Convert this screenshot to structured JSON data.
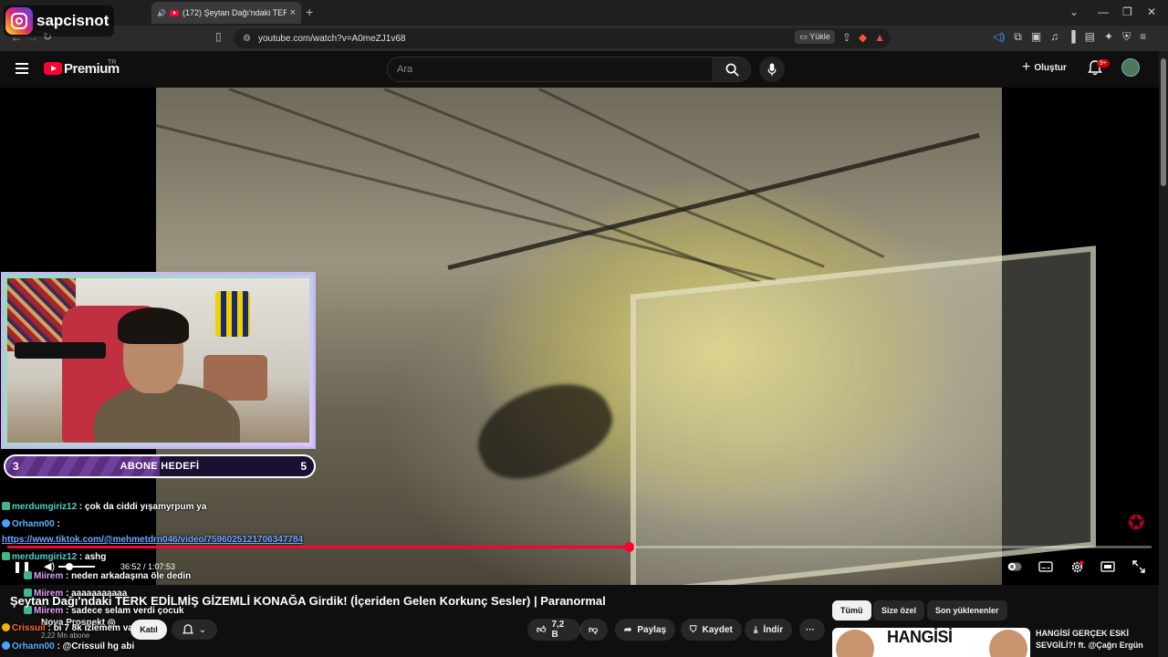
{
  "browser": {
    "tab_title": "(172) Şeytan Dağı'ndaki TERK",
    "tab_close": "×",
    "new_tab": "+",
    "url": "youtube.com/watch?v=A0meZJ1v68",
    "install_label": "Yükle"
  },
  "overlay": {
    "instagram_handle": "sapcisnot"
  },
  "yt_header": {
    "logo_text": "Premium",
    "region": "TR",
    "search_placeholder": "Ara",
    "create_label": "Oluştur",
    "notification_count": "9+"
  },
  "player": {
    "current_time": "36:52",
    "duration": "1:07:53",
    "time_display": "36:52 / 1:07:53",
    "progress_fraction": 0.543
  },
  "sub_goal": {
    "current": "3",
    "target": "5",
    "label": "ABONE HEDEFİ",
    "fraction": 0.5
  },
  "chat": [
    {
      "user": "merdumgiriz12",
      "sep": " : ",
      "text": "çok da ciddi yışamyrpum ya"
    },
    {
      "user": "Orhann00",
      "sep": " : ",
      "text": ""
    },
    {
      "user": "",
      "sep": "",
      "text": "https://www.tiktok.com/@mehmetdrn046/video/7596025121706347784"
    },
    {
      "user": "merdumgiriz12",
      "sep": " : ",
      "text": "ashg"
    },
    {
      "user": "Miirem",
      "sep": " : ",
      "text": "neden arkadaşına öle dedin"
    },
    {
      "user": "Miirem",
      "sep": " : ",
      "text": "aaaaaaaaaaa"
    },
    {
      "user": "Miirem",
      "sep": " : ",
      "text": "sadece selam verdi çocuk"
    },
    {
      "user": "Crissuil",
      "sep": " : ",
      "text": "bi 7 8k izlemem vardı"
    },
    {
      "user": "Orhann00",
      "sep": " : ",
      "text": "@Crissuil hg abi"
    }
  ],
  "video": {
    "title": "Şeytan Dağı'ndaki TERK EDİLMİŞ GİZEMLİ KONAĞA Girdik! (İçeriden Gelen Korkunç Sesler) | Paranormal",
    "channel": "Nova Prospekt",
    "channel_suffix": "◎",
    "subscribers": "2,22 Mn abone",
    "join_label": "Katıl",
    "likes": "7,2 B",
    "share_label": "Paylaş",
    "save_label": "Kaydet",
    "download_label": "İndir",
    "more_label": "···"
  },
  "chips": [
    "Tümü",
    "Size özel",
    "Son yüklenenler"
  ],
  "recommendation": {
    "thumb_text": "HANGİSİ",
    "title": "HANGİSİ GERÇEK ESKİ SEVGİLİ?! ft. @Çağrı Ergün"
  },
  "colors": {
    "yt_red": "#ff0033",
    "background": "#0f0f0f",
    "goal_purple": "#6f3f9a"
  }
}
